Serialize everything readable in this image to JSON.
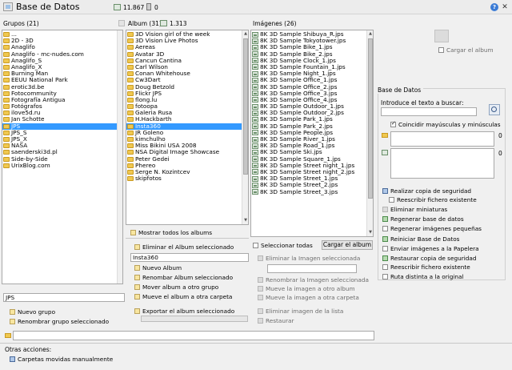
{
  "window": {
    "title": "Base de Datos",
    "image_count": "11.867",
    "trash_count": "0",
    "help_symbol": "?",
    "close_symbol": "✕"
  },
  "groups": {
    "header": "Grupos (21)",
    "items": [
      "...",
      "2D - 3D",
      "Anaglifo",
      "Anaglifo - mc-nudes.com",
      "Anaglifo_S",
      "Anaglifo_X",
      "Burning Man",
      "EEUU National Park",
      "erotic3d.be",
      "Fotocommunity",
      "Fotografía Antigua",
      "Fotógrafos",
      "ilove5d.ru",
      "Jan Schotte",
      "JPS",
      "JPS_S",
      "JPS_X",
      "NASA",
      "saenderski3d.pl",
      "Side-by-Side",
      "UrixBlog.com"
    ],
    "selected_index": 14,
    "name_value": "JPS",
    "actions": [
      "Nuevo grupo",
      "Renombrar grupo seleccionado"
    ]
  },
  "albums": {
    "header": "Album (31)",
    "count": "1.313",
    "items": [
      "3D Vision girl of the week",
      "3D Vision Live Photos",
      "Aereas",
      "Avatar 3D",
      "Cancun Cantina",
      "Carl Wilson",
      "Conan Whitehouse",
      "Cw3Dart",
      "Doug Betzold",
      "Flickr JPS",
      "flong.lu",
      "fotoopa",
      "Galeria Rusa",
      "H.Hackbarth",
      "Insta360",
      "JR Goleno",
      "kimchulho",
      "Miss Bikini USA 2008",
      "NSA Digital Image Showcase",
      "Peter Gedei",
      "Phereo",
      "Serge N. Kozintcev",
      "skipfotos"
    ],
    "selected_index": 14,
    "show_all": "Mostrar todos los albums",
    "delete_selected": "Eliminar el Album seleccionado",
    "name_value": "Insta360",
    "actions": [
      "Nuevo Album",
      "Renombar Album seleccionado",
      "Mover album a otro grupo",
      "Mueve el album a otra carpeta"
    ],
    "export": "Exportar el album seleccionado"
  },
  "images": {
    "header": "Imágenes (26)",
    "items": [
      "8K 3D Sample Shibuya_R.jps",
      "8K 3D Sample Tokyotower.jps",
      "8K 3D Sample Bike_1.jps",
      "8K 3D Sample Bike_2.jps",
      "8K 3D Sample Clock_1.jps",
      "8K 3D Sample Fountain_1.jps",
      "8K 3D Sample Night_1.jps",
      "8K 3D Sample Office_1.jps",
      "8K 3D Sample Office_2.jps",
      "8K 3D Sample Office_3.jps",
      "8K 3D Sample Office_4.jps",
      "8K 3D Sample Outdoor_1.jps",
      "8K 3D Sample Outdoor_2.jps",
      "8K 3D Sample Park_1.jps",
      "8K 3D Sample Park_2.jps",
      "8K 3D Sample People.jps",
      "8K 3D Sample River_1.jps",
      "8K 3D Sample Road_1.jps",
      "8K 3D Sample Ski.jps",
      "8K 3D Sample Square_1.jps",
      "8K 3D Sample Street night_1.jps",
      "8K 3D Sample Street night_2.jps",
      "8K 3D Sample Street_1.jps",
      "8K 3D Sample Street_2.jps",
      "8K 3D Sample Street_3.jps"
    ],
    "select_all": "Seleccionar todas",
    "load_album": "Cargar el album",
    "delete_selected": "Eliminar la Imagen seleccionada",
    "actions": [
      "Renombrar la Imagen seleccionada",
      "Mueve la imagen a otro album",
      "Mueve la imagen a otra carpeta"
    ],
    "delete_from_list": "Eliminar imagen de la lista",
    "restore": "Restaurar"
  },
  "right": {
    "load_album": "Cargar el album",
    "section_title": "Base de Datos",
    "search_label": "Introduce el texto a buscar:",
    "match_case": "Coincidir mayúsculas y minúsculas",
    "result_count_1": "0",
    "result_count_2": "0",
    "backup": "Realizar copia de seguridad",
    "overwrite": "Reescribir fichero existente",
    "delete_thumbs": "Eliminar miniaturas",
    "regen_db": "Regenerar base de datos",
    "regen_small": "Regenerar imágenes pequeñas",
    "restart_db": "Reiniciar Base de Datos",
    "send_trash": "Enviar imágenes a la Papelera",
    "restore_backup": "Restaurar copia de seguridad",
    "overwrite2": "Reescribir fichero existente",
    "other_path": "Ruta distinta a la original"
  },
  "bottom": {
    "other_actions": "Otras acciones:",
    "moved_folders": "Carpetas movidas manualmente"
  }
}
